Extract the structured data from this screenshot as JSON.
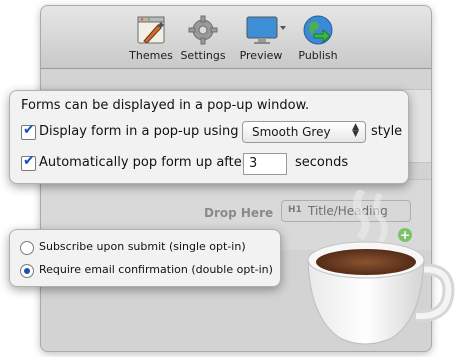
{
  "toolbar": {
    "items": [
      {
        "label": "Themes",
        "icon": "themes-icon"
      },
      {
        "label": "Settings",
        "icon": "gear-icon"
      },
      {
        "label": "Preview",
        "icon": "monitor-icon"
      },
      {
        "label": "Publish",
        "icon": "globe-icon"
      }
    ]
  },
  "canvas": {
    "drop_here": "Drop Here",
    "field_chip_mark": "H1",
    "field_chip_label": "Title/Heading",
    "add_symbol": "+"
  },
  "popup_panel": {
    "heading": "Forms can be displayed in a pop-up window.",
    "display_option": {
      "label": "Display form in a pop-up using",
      "checked": true,
      "style_value": "Smooth Grey",
      "style_suffix": "style"
    },
    "auto_popup_option": {
      "label": "Automatically pop form up after",
      "checked": true,
      "seconds_value": "3",
      "seconds_suffix": "seconds"
    }
  },
  "subscribe_panel": {
    "options": [
      {
        "label": "Subscribe upon submit (single opt-in)",
        "selected": false
      },
      {
        "label": "Require email confirmation (double opt-in)",
        "selected": true
      }
    ]
  },
  "colors": {
    "accent": "#1b4fb8",
    "coffee": "#6b3a1f"
  }
}
